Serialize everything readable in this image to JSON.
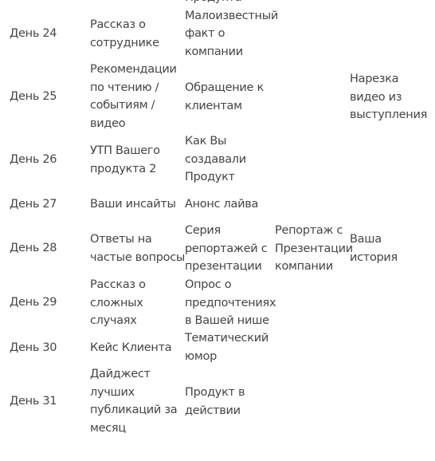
{
  "rows": [
    {
      "day": "День 24",
      "c1": "Рассказ о\nсотруднике",
      "c2": "Продукта\nМалоизвестный\nфакт о\nкомпании",
      "c3": "",
      "c4": ""
    },
    {
      "day": "День 25",
      "c1": "Рекомендации\nпо чтению /\nсобытиям /\nвидео",
      "c2": "Обращение к\nклиентам",
      "c3": "",
      "c4": "Нарезка\nвидео из\nвыступления"
    },
    {
      "day": "День 26",
      "c1": "УТП Вашего\nпродукта 2",
      "c2": "Как Вы\nсоздавали\nПродукт",
      "c3": "",
      "c4": ""
    },
    {
      "day": "День 27",
      "c1": "Ваши инсайты",
      "c2": "Анонс лайва",
      "c3": "",
      "c4": ""
    },
    {
      "day": "День 28",
      "c1": "Ответы на\nчастые вопросы",
      "c2": "Серия\nрепортажей с\nпрезентации",
      "c3": "Репортаж с\nПрезентации\nкомпании",
      "c4": "Ваша\nистория"
    },
    {
      "day": "День 29",
      "c1": "Рассказ о\nсложных\nслучаях",
      "c2": "Опрос о\nпредпочтениях\nв Вашей нише",
      "c3": "",
      "c4": ""
    },
    {
      "day": "День 30",
      "c1": "Кейс Клиента",
      "c2": "Тематический\nюмор",
      "c3": "",
      "c4": ""
    },
    {
      "day": "День 31",
      "c1": "Дайджест\nлучших\nпубликаций за\nмесяц",
      "c2": "Продукт в\nдействии",
      "c3": "",
      "c4": ""
    }
  ]
}
